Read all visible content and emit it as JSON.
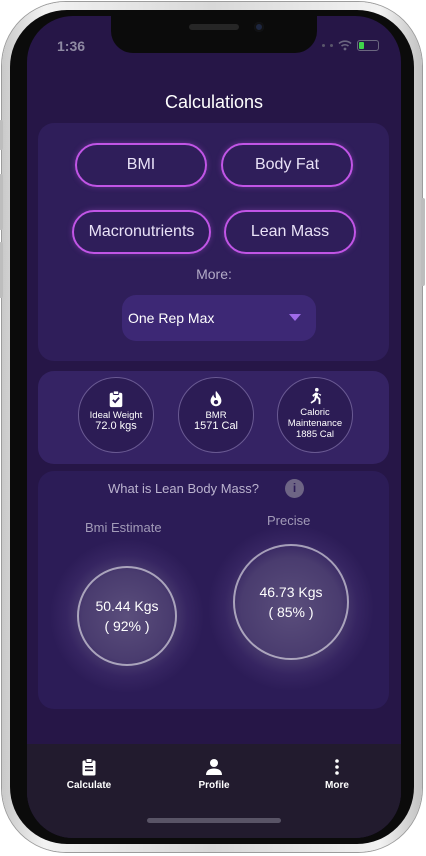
{
  "status": {
    "time": "1:36"
  },
  "header": {
    "title": "Calculations"
  },
  "calculators": {
    "bmi": "BMI",
    "body_fat": "Body Fat",
    "macronutrients": "Macronutrients",
    "lean_mass": "Lean Mass",
    "more_label": "More:",
    "dropdown_value": "One Rep Max"
  },
  "stats": {
    "ideal_weight": {
      "label": "Ideal Weight",
      "value": "72.0 kgs",
      "icon": "clipboard-check-icon"
    },
    "bmr": {
      "label": "BMR",
      "value": "1571 Cal",
      "icon": "flame-icon"
    },
    "caloric": {
      "label_line1": "Caloric",
      "label_line2": "Maintenance",
      "value": "1885 Cal",
      "icon": "running-person-icon"
    }
  },
  "lean": {
    "question": "What is Lean Body Mass?",
    "info_symbol": "i",
    "bmi_estimate": {
      "label": "Bmi Estimate",
      "value": "50.44 Kgs",
      "percent": "( 92% )"
    },
    "precise": {
      "label": "Precise",
      "value": "46.73 Kgs",
      "percent": "( 85% )"
    }
  },
  "tabs": [
    {
      "label": "Calculate",
      "icon": "clipboard-icon"
    },
    {
      "label": "Profile",
      "icon": "person-icon"
    },
    {
      "label": "More",
      "icon": "more-vertical-icon"
    }
  ],
  "colors": {
    "background": "#261647",
    "accent": "#c155e6",
    "card": "#2f1e5a",
    "tabbar": "#221b2e"
  }
}
